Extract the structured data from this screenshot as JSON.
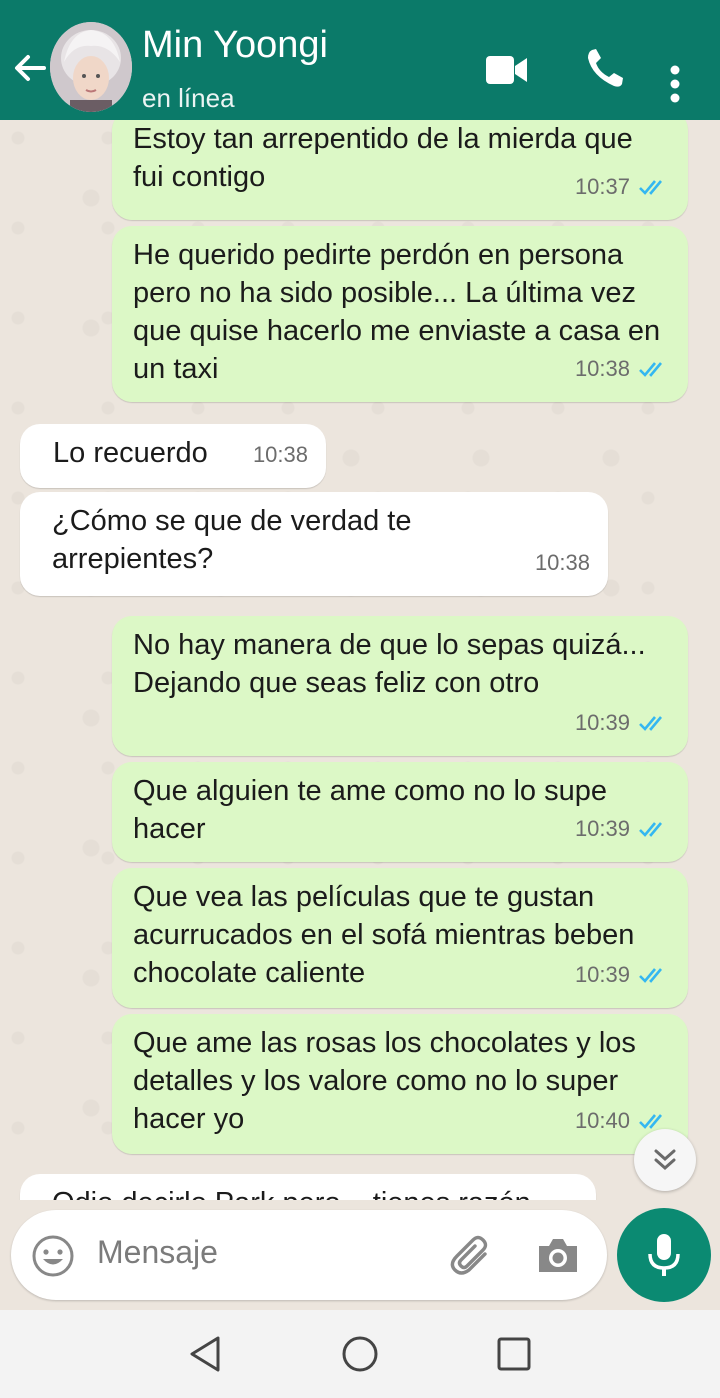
{
  "header": {
    "contact_name": "Min Yoongi",
    "status": "en línea",
    "icons": [
      "back-arrow-icon",
      "video-call-icon",
      "phone-icon",
      "more-options-icon"
    ]
  },
  "messages": [
    {
      "direction": "out",
      "text": "Estoy tan arrepentido de la mierda que fui contigo",
      "time": "10:37",
      "ticks": "double-blue"
    },
    {
      "direction": "out",
      "text": "He querido pedirte perdón en persona pero no ha sido posible... La última vez que quise hacerlo me enviaste a casa en un taxi",
      "time": "10:38",
      "ticks": "double-blue"
    },
    {
      "direction": "in",
      "text": "Lo recuerdo",
      "time": "10:38"
    },
    {
      "direction": "in",
      "text": "¿Cómo se que de verdad te arrepientes?",
      "time": "10:38"
    },
    {
      "direction": "out",
      "text": "No hay manera de que lo sepas quizá... Dejando que seas feliz con otro",
      "time": "10:39",
      "ticks": "double-blue"
    },
    {
      "direction": "out",
      "text": "Que alguien te ame como no lo supe hacer",
      "time": "10:39",
      "ticks": "double-blue"
    },
    {
      "direction": "out",
      "text": "Que vea las películas que te gustan acurrucados en el sofá mientras beben chocolate caliente",
      "time": "10:39",
      "ticks": "double-blue"
    },
    {
      "direction": "out",
      "text": "Que ame las rosas los chocolates y los detalles y los valore como no lo super hacer yo",
      "time": "10:40",
      "ticks": "double-blue"
    },
    {
      "direction": "in",
      "text": "Odio decirlo Park pero... tienes razón"
    }
  ],
  "composer": {
    "placeholder": "Mensaje",
    "icons": [
      "emoji-icon",
      "attach-icon",
      "camera-icon",
      "mic-icon"
    ]
  },
  "navigation": {
    "icons": [
      "nav-back-icon",
      "nav-home-icon",
      "nav-recents-icon"
    ]
  },
  "colors": {
    "header": "#0b7a69",
    "outgoing": "#dcf8c6",
    "incoming": "#ffffff",
    "ticks": "#34b7f1",
    "fab": "#0b8a72"
  }
}
